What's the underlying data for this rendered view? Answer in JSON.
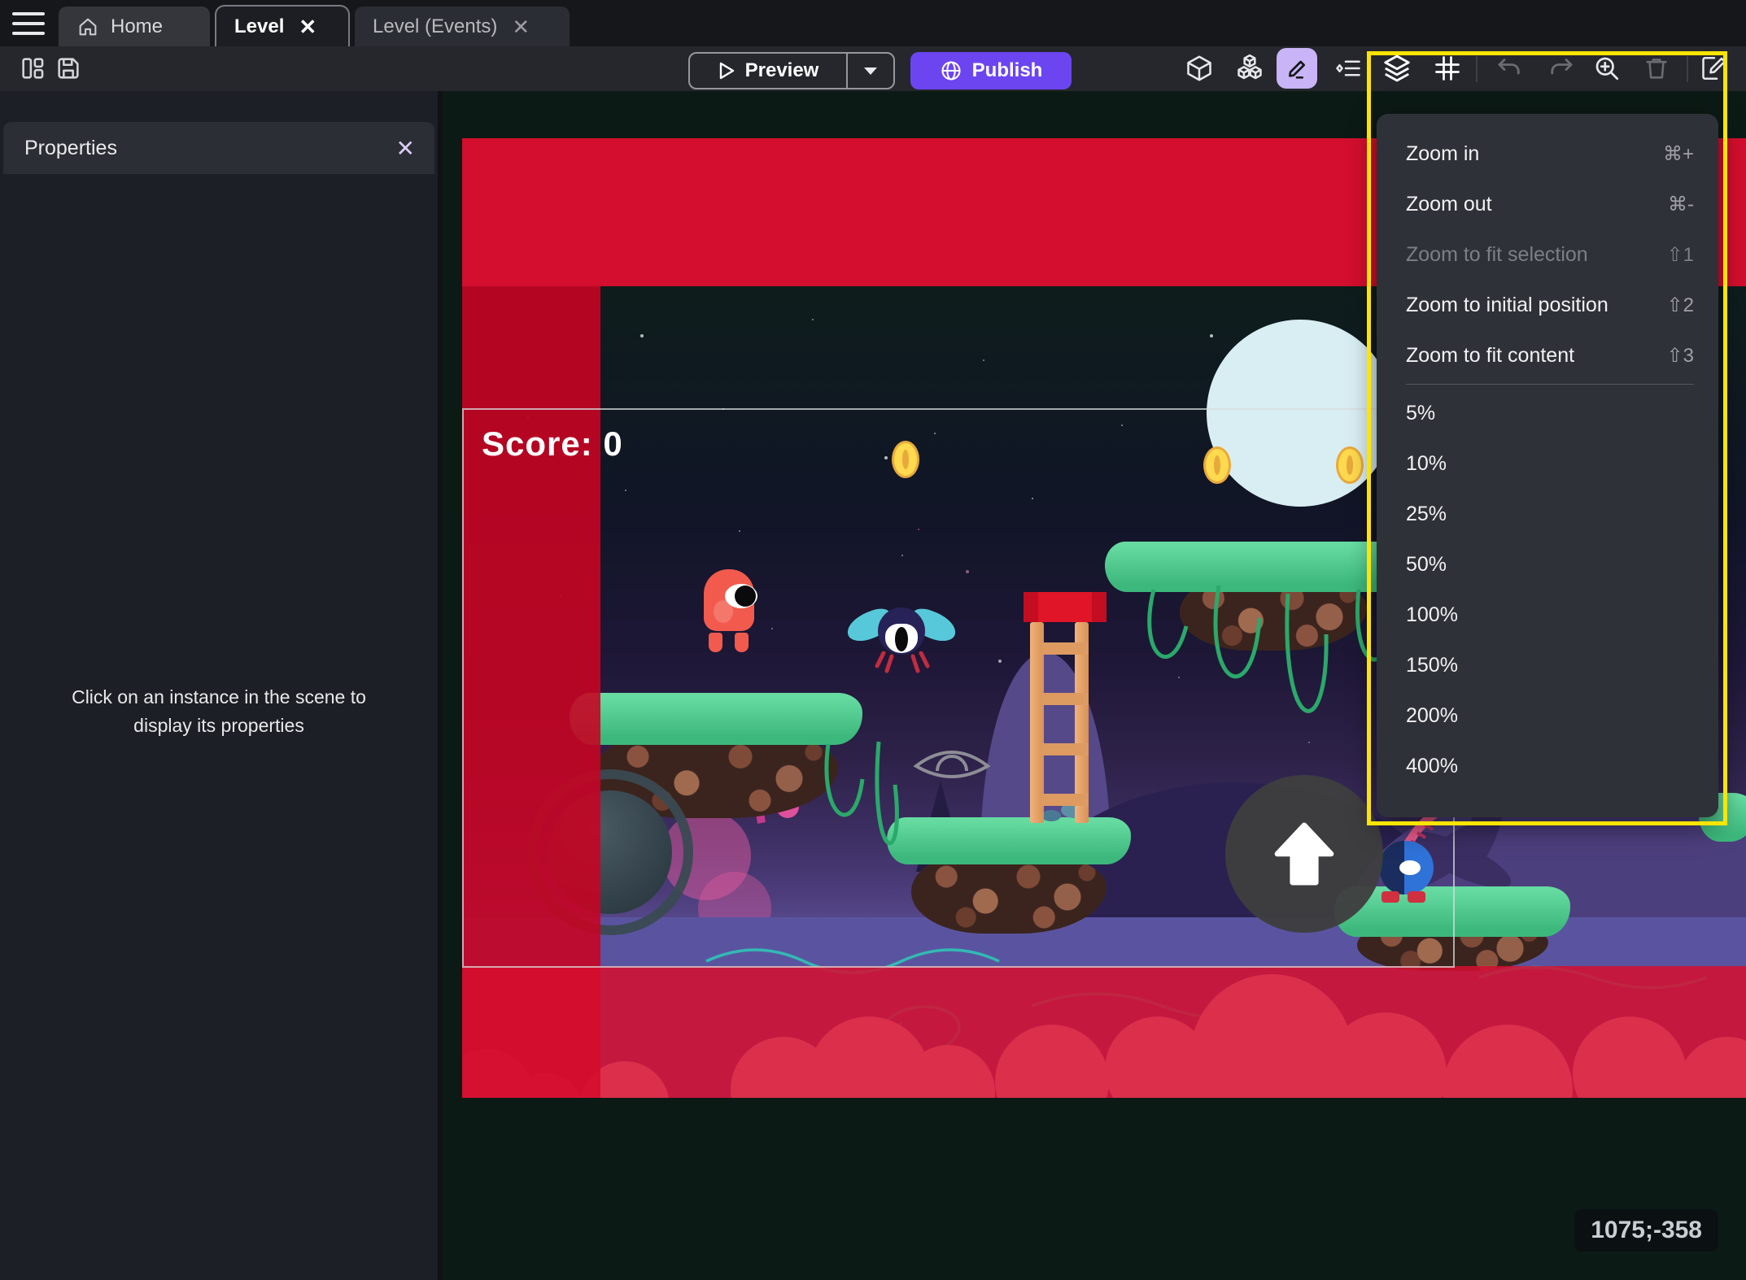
{
  "titlebar": {
    "tabs": [
      {
        "label": "Home",
        "icon": "home-icon",
        "active": false
      },
      {
        "label": "Level",
        "active": true,
        "close_icon": "close-icon"
      },
      {
        "label": "Level (Events)",
        "active": false,
        "close_icon": "close-icon"
      }
    ],
    "menu_icon": "hamburger-menu-icon",
    "close_glyph": "✕"
  },
  "toolbar": {
    "left_icons": [
      {
        "name": "layout-panels-icon"
      },
      {
        "name": "save-icon"
      }
    ],
    "preview_label": "Preview",
    "preview_icons": {
      "play": "play-icon",
      "caret": "caret-down-icon"
    },
    "publish_label": "Publish",
    "publish_icon": "globe-icon",
    "right_icons": [
      {
        "name": "object-cube-icon",
        "disabled": false
      },
      {
        "name": "prefab-cubes-icon",
        "disabled": false
      },
      {
        "name": "edit-pencil-icon",
        "disabled": false,
        "selected": true
      },
      {
        "name": "instances-list-icon",
        "disabled": false
      },
      {
        "name": "layers-icon",
        "disabled": false
      },
      {
        "name": "grid-icon",
        "disabled": false
      },
      {
        "name": "undo-icon",
        "disabled": true
      },
      {
        "name": "redo-icon",
        "disabled": true
      },
      {
        "name": "zoom-in-icon",
        "disabled": false
      },
      {
        "name": "trash-icon",
        "disabled": true
      },
      {
        "name": "edit-scene-icon",
        "disabled": false
      }
    ]
  },
  "properties_panel": {
    "title": "Properties",
    "close_icon": "close-icon",
    "close_glyph": "✕",
    "empty_message_line1": "Click on an instance in the scene to",
    "empty_message_line2": "display its properties"
  },
  "zoom_menu": {
    "items": [
      {
        "label": "Zoom in",
        "shortcut": "⌘+",
        "disabled": false
      },
      {
        "label": "Zoom out",
        "shortcut": "⌘-",
        "disabled": false
      },
      {
        "label": "Zoom to fit selection",
        "shortcut": "⇧1",
        "disabled": true
      },
      {
        "label": "Zoom to initial position",
        "shortcut": "⇧2",
        "disabled": false
      },
      {
        "label": "Zoom to fit content",
        "shortcut": "⇧3",
        "disabled": false
      }
    ],
    "zoom_levels": [
      {
        "label": "5%"
      },
      {
        "label": "10%"
      },
      {
        "label": "25%"
      },
      {
        "label": "50%"
      },
      {
        "label": "100%"
      },
      {
        "label": "150%"
      },
      {
        "label": "200%"
      },
      {
        "label": "400%"
      }
    ]
  },
  "scene": {
    "score_label": "Score: 0",
    "coordinates": "1075;-358",
    "objects": [
      "red-character",
      "fly-enemy",
      "coin",
      "moon",
      "ladder",
      "platform",
      "joystick-control",
      "jump-button",
      "snail-character",
      "eye-placeholder"
    ]
  },
  "colors": {
    "accent_purple": "#6c45f1",
    "selection_lavender": "#c8b4f6",
    "highlight_yellow": "#ffe400",
    "scene_red": "#d30e2e",
    "canvas_background": "#0c1a15"
  }
}
